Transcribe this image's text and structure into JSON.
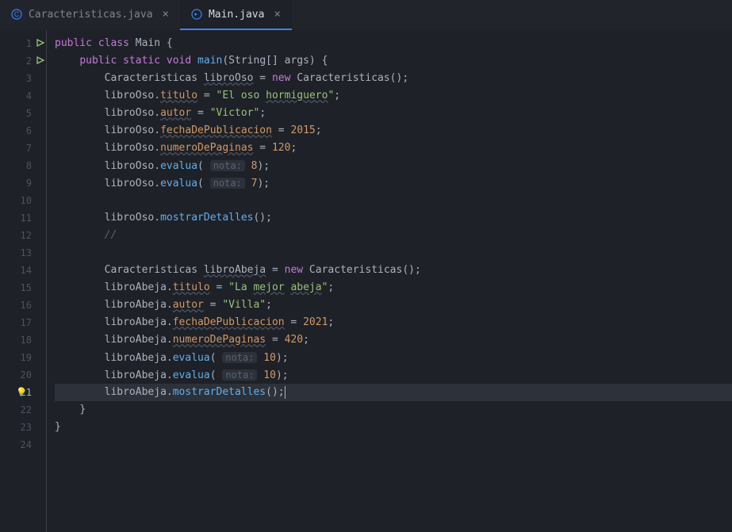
{
  "tabs": [
    {
      "label": "Caracteristicas.java",
      "active": false
    },
    {
      "label": "Main.java",
      "active": true
    }
  ],
  "lineNumbers": [
    "1",
    "2",
    "3",
    "4",
    "5",
    "6",
    "7",
    "8",
    "9",
    "10",
    "11",
    "12",
    "13",
    "14",
    "15",
    "16",
    "17",
    "18",
    "19",
    "20",
    "21",
    "22",
    "23",
    "24"
  ],
  "currentLine": 21,
  "runLines": [
    1,
    2
  ],
  "bulbLine": 21,
  "code": {
    "l1": {
      "kw1": "public",
      "kw2": "class",
      "name": "Main",
      "open": " {"
    },
    "l2": {
      "kw1": "public",
      "kw2": "static",
      "kw3": "void",
      "fn": "main",
      "args": "(String[] args) {"
    },
    "l3": {
      "type": "Caracteristicas ",
      "var": "libroOso",
      "eq": " = ",
      "kw": "new",
      "ctor": " Caracteristicas();"
    },
    "l4": {
      "var": "libroOso.",
      "field": "titulo",
      "eq": " = ",
      "str1": "\"El oso ",
      "str2": "hormiguero",
      "str3": "\"",
      "end": ";"
    },
    "l5": {
      "var": "libroOso.",
      "field": "autor",
      "eq": " = ",
      "str": "\"Victor\"",
      "end": ";"
    },
    "l6": {
      "var": "libroOso.",
      "field": "fechaDePublicacion",
      "eq": " = ",
      "num": "2015",
      "end": ";"
    },
    "l7": {
      "var": "libroOso.",
      "field": "numeroDePaginas",
      "eq": " = ",
      "num": "120",
      "end": ";"
    },
    "l8": {
      "var": "libroOso.",
      "fn": "evalua",
      "open": "( ",
      "hint": "nota:",
      "num": " 8",
      "end": ");"
    },
    "l9": {
      "var": "libroOso.",
      "fn": "evalua",
      "open": "( ",
      "hint": "nota:",
      "num": " 7",
      "end": ");"
    },
    "l11": {
      "var": "libroOso.",
      "fn": "mostrarDetalles",
      "end": "();"
    },
    "l12": {
      "cmt": "//"
    },
    "l14": {
      "type": "Caracteristicas ",
      "var": "libroAbeja",
      "eq": " = ",
      "kw": "new",
      "ctor": " Caracteristicas();"
    },
    "l15": {
      "var": "libroAbeja.",
      "field": "titulo",
      "eq": " = ",
      "str1": "\"La ",
      "str2": "mejor",
      "str3": " ",
      "str4": "abeja",
      "str5": "\"",
      "end": ";"
    },
    "l16": {
      "var": "libroAbeja.",
      "field": "autor",
      "eq": " = ",
      "str": "\"Villa\"",
      "end": ";"
    },
    "l17": {
      "var": "libroAbeja.",
      "field": "fechaDePublicacion",
      "eq": " = ",
      "num": "2021",
      "end": ";"
    },
    "l18": {
      "var": "libroAbeja.",
      "field": "numeroDePaginas",
      "eq": " = ",
      "num": "420",
      "end": ";"
    },
    "l19": {
      "var": "libroAbeja.",
      "fn": "evalua",
      "open": "( ",
      "hint": "nota:",
      "num": " 10",
      "end": ");"
    },
    "l20": {
      "var": "libroAbeja.",
      "fn": "evalua",
      "open": "( ",
      "hint": "nota:",
      "num": " 10",
      "end": ");"
    },
    "l21": {
      "var": "libroAbeja.",
      "fn": "mostrarDetalles",
      "end": "();"
    },
    "l22": {
      "close": "}"
    },
    "l23": {
      "close": "}"
    }
  }
}
